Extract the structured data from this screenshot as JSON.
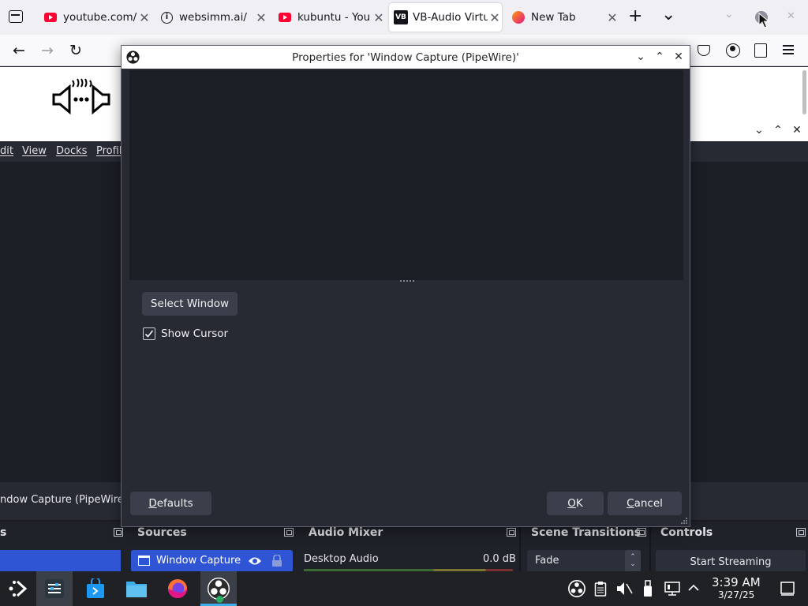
{
  "browser": {
    "tabs": [
      {
        "title": "youtube.com/",
        "icon": "youtube-icon"
      },
      {
        "title": "websimm.ai/",
        "icon": "info-icon"
      },
      {
        "title": "kubuntu - You",
        "icon": "youtube-icon"
      },
      {
        "title": "VB-Audio Virtu",
        "icon": "vb-audio-icon",
        "active": true
      },
      {
        "title": "New Tab",
        "icon": "firefox-icon"
      }
    ],
    "new_tab_label": "+",
    "tab_list_label": "⌄"
  },
  "obs": {
    "menu": [
      "dit",
      "View",
      "Docks",
      "Profil"
    ],
    "source_bar_name": "ndow Capture (PipeWire",
    "docks": {
      "sources_title": "Sources",
      "source_item": "Window Capture (I",
      "audio_mixer_title": "Audio Mixer",
      "audio_channel": "Desktop Audio",
      "audio_level": "0.0 dB",
      "scene_transitions_title": "Scene Transitions",
      "transition": "Fade",
      "controls_title": "Controls",
      "start_streaming": "Start Streaming"
    }
  },
  "dialog": {
    "title": "Properties for 'Window Capture (PipeWire)'",
    "select_window": "Select Window",
    "show_cursor": "Show Cursor",
    "show_cursor_checked": true,
    "defaults_pre": "",
    "defaults_ul": "D",
    "defaults_post": "efaults",
    "ok_ul": "O",
    "ok_post": "K",
    "cancel_ul": "C",
    "cancel_post": "ancel"
  },
  "taskbar": {
    "time": "3:39 AM",
    "date": "3/27/25"
  }
}
